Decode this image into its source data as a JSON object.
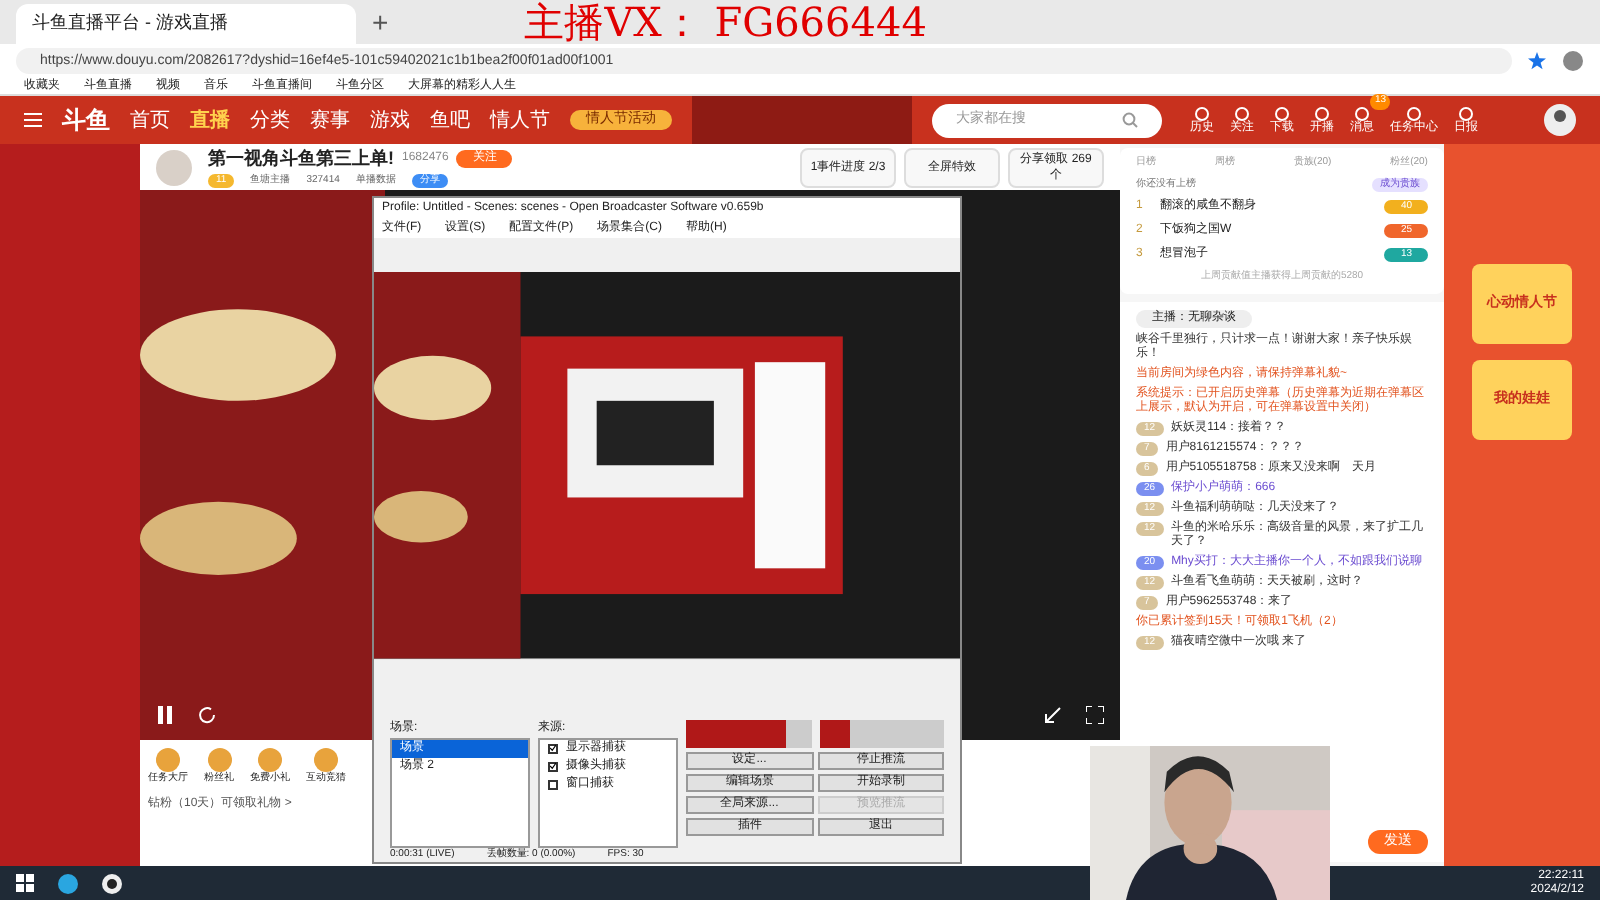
{
  "browser": {
    "tab_title": "斗鱼直播平台 - 游戏直播",
    "new_tab": "+",
    "overlay_text": "主播VX： FG666444",
    "url": "https://www.douyu.com/2082617?dyshid=16ef4e5-101c59402021c1b1bea2f00f01ad00f1001",
    "bookmarks": [
      "收藏夹",
      "斗鱼直播",
      "视频",
      "音乐",
      "斗鱼直播间",
      "斗鱼分区",
      "大屏幕的精彩人人生"
    ]
  },
  "site_header": {
    "logo": "斗鱼",
    "nav": [
      {
        "label": "首页",
        "selected": false
      },
      {
        "label": "直播",
        "selected": true
      },
      {
        "label": "分类",
        "selected": false
      },
      {
        "label": "赛事",
        "selected": false
      },
      {
        "label": "游戏",
        "selected": false
      },
      {
        "label": "鱼吧",
        "selected": false
      },
      {
        "label": "情人节",
        "selected": false
      }
    ],
    "promo": "情人节活动",
    "search": {
      "placeholder": "大家都在搜"
    },
    "actions": [
      "历史",
      "关注",
      "下载",
      "开播",
      "消息",
      "任务中心",
      "日报"
    ],
    "message_badge": "13"
  },
  "room": {
    "title": "第一视角斗鱼第三上单!",
    "room_id": "1682476",
    "follow": "关注",
    "level": "11",
    "stats": [
      "鱼塘主播",
      "327414",
      "单播数据"
    ],
    "tag": "分享",
    "cards": [
      "1事件进度 2/3",
      "全屏特效",
      "分享领取 269个"
    ]
  },
  "gifts": [
    {
      "label": "任务大厅"
    },
    {
      "label": "粉丝礼"
    },
    {
      "label": "免费小礼"
    },
    {
      "label": "互动竞猜"
    }
  ],
  "gift_footer": "钻粉（10天）可领取礼物 >",
  "rank": {
    "columns": [
      "日榜",
      "周榜",
      "贵族(20)",
      "粉丝(20)"
    ],
    "note": "你还没有上榜",
    "join": "成为贵族",
    "items": [
      {
        "rank": "1",
        "name": "翻滚的咸鱼不翻身",
        "level": "40",
        "color": "#f2b01e"
      },
      {
        "rank": "2",
        "name": "下饭狗之国W",
        "level": "25",
        "color": "#f0662c"
      },
      {
        "rank": "3",
        "name": "想冒泡子",
        "level": "13",
        "color": "#1fa8a0"
      }
    ],
    "footer": "上周贡献值主播获得上周贡献的5280"
  },
  "chat": {
    "host": "主播：无聊杂谈",
    "messages": [
      {
        "kind": "plain",
        "text": "峡谷千里独行，只计求一点！谢谢大家！亲子快乐娱乐！"
      },
      {
        "kind": "notice",
        "text": "当前房间为绿色内容，请保持弹幕礼貌~"
      },
      {
        "kind": "notice",
        "text": "系统提示：已开启历史弹幕（历史弹幕为近期在弹幕区上展示，默认为开启，可在弹幕设置中关闭）"
      },
      {
        "kind": "user",
        "badge": "12",
        "text": "妖妖灵114：接着？？"
      },
      {
        "kind": "user",
        "badge": "7",
        "text": "用户8161215574：？？？"
      },
      {
        "kind": "user",
        "badge": "6",
        "text": "用户5105518758：原来又没来啊　天月"
      },
      {
        "kind": "fan",
        "badge": "26",
        "text": "保护小户萌萌：666"
      },
      {
        "kind": "user",
        "badge": "12",
        "text": "斗鱼福利萌萌哒：几天没来了？"
      },
      {
        "kind": "user",
        "badge": "12",
        "text": "斗鱼的米哈乐乐：高级音量的风景，来了扩工几天了？"
      },
      {
        "kind": "fan",
        "badge": "20",
        "text": "Mhy买打：大大主播你一个人，不如跟我们说聊"
      },
      {
        "kind": "user",
        "badge": "12",
        "text": "斗鱼看飞鱼萌萌：天天被刷，这时？"
      },
      {
        "kind": "user",
        "badge": "7",
        "text": "用户5962553748：来了"
      },
      {
        "kind": "notice",
        "text": "你已累计签到15天！可领取1飞机（2）"
      },
      {
        "kind": "user",
        "badge": "12",
        "text": "猫夜晴空微中一次哦 来了"
      }
    ],
    "send": "发送"
  },
  "side_ads": [
    "心动情人节",
    "我的娃娃"
  ],
  "obs": {
    "title": "Profile: Untitled - Scenes: scenes - Open Broadcaster Software v0.659b",
    "menu": [
      "文件(F)",
      "设置(S)",
      "配置文件(P)",
      "场景集合(C)",
      "帮助(H)"
    ],
    "scenes_label": "场景:",
    "scenes": [
      {
        "label": "场景",
        "selected": true
      },
      {
        "label": "场景 2",
        "selected": false
      }
    ],
    "sources_label": "来源:",
    "sources": [
      {
        "label": "显示器捕获",
        "checked": true
      },
      {
        "label": "摄像头捕获",
        "checked": true
      },
      {
        "label": "窗口捕获",
        "checked": false
      }
    ],
    "mic_meter": {
      "level": 0.8
    },
    "speaker_meter": {
      "level": 0.25
    },
    "buttons": [
      {
        "label": "设定...",
        "disabled": false
      },
      {
        "label": "停止推流",
        "disabled": false
      },
      {
        "label": "编辑场景",
        "disabled": false
      },
      {
        "label": "开始录制",
        "disabled": false
      },
      {
        "label": "全局来源...",
        "disabled": false
      },
      {
        "label": "预览推流",
        "disabled": true
      },
      {
        "label": "插件",
        "disabled": false
      },
      {
        "label": "退出",
        "disabled": false
      }
    ],
    "status": [
      "0:00:31 (LIVE)",
      "丢帧数量: 0 (0.00%)",
      "FPS: 30"
    ]
  },
  "taskbar": {
    "time": "22:22:11",
    "date": "2024/2/12"
  }
}
